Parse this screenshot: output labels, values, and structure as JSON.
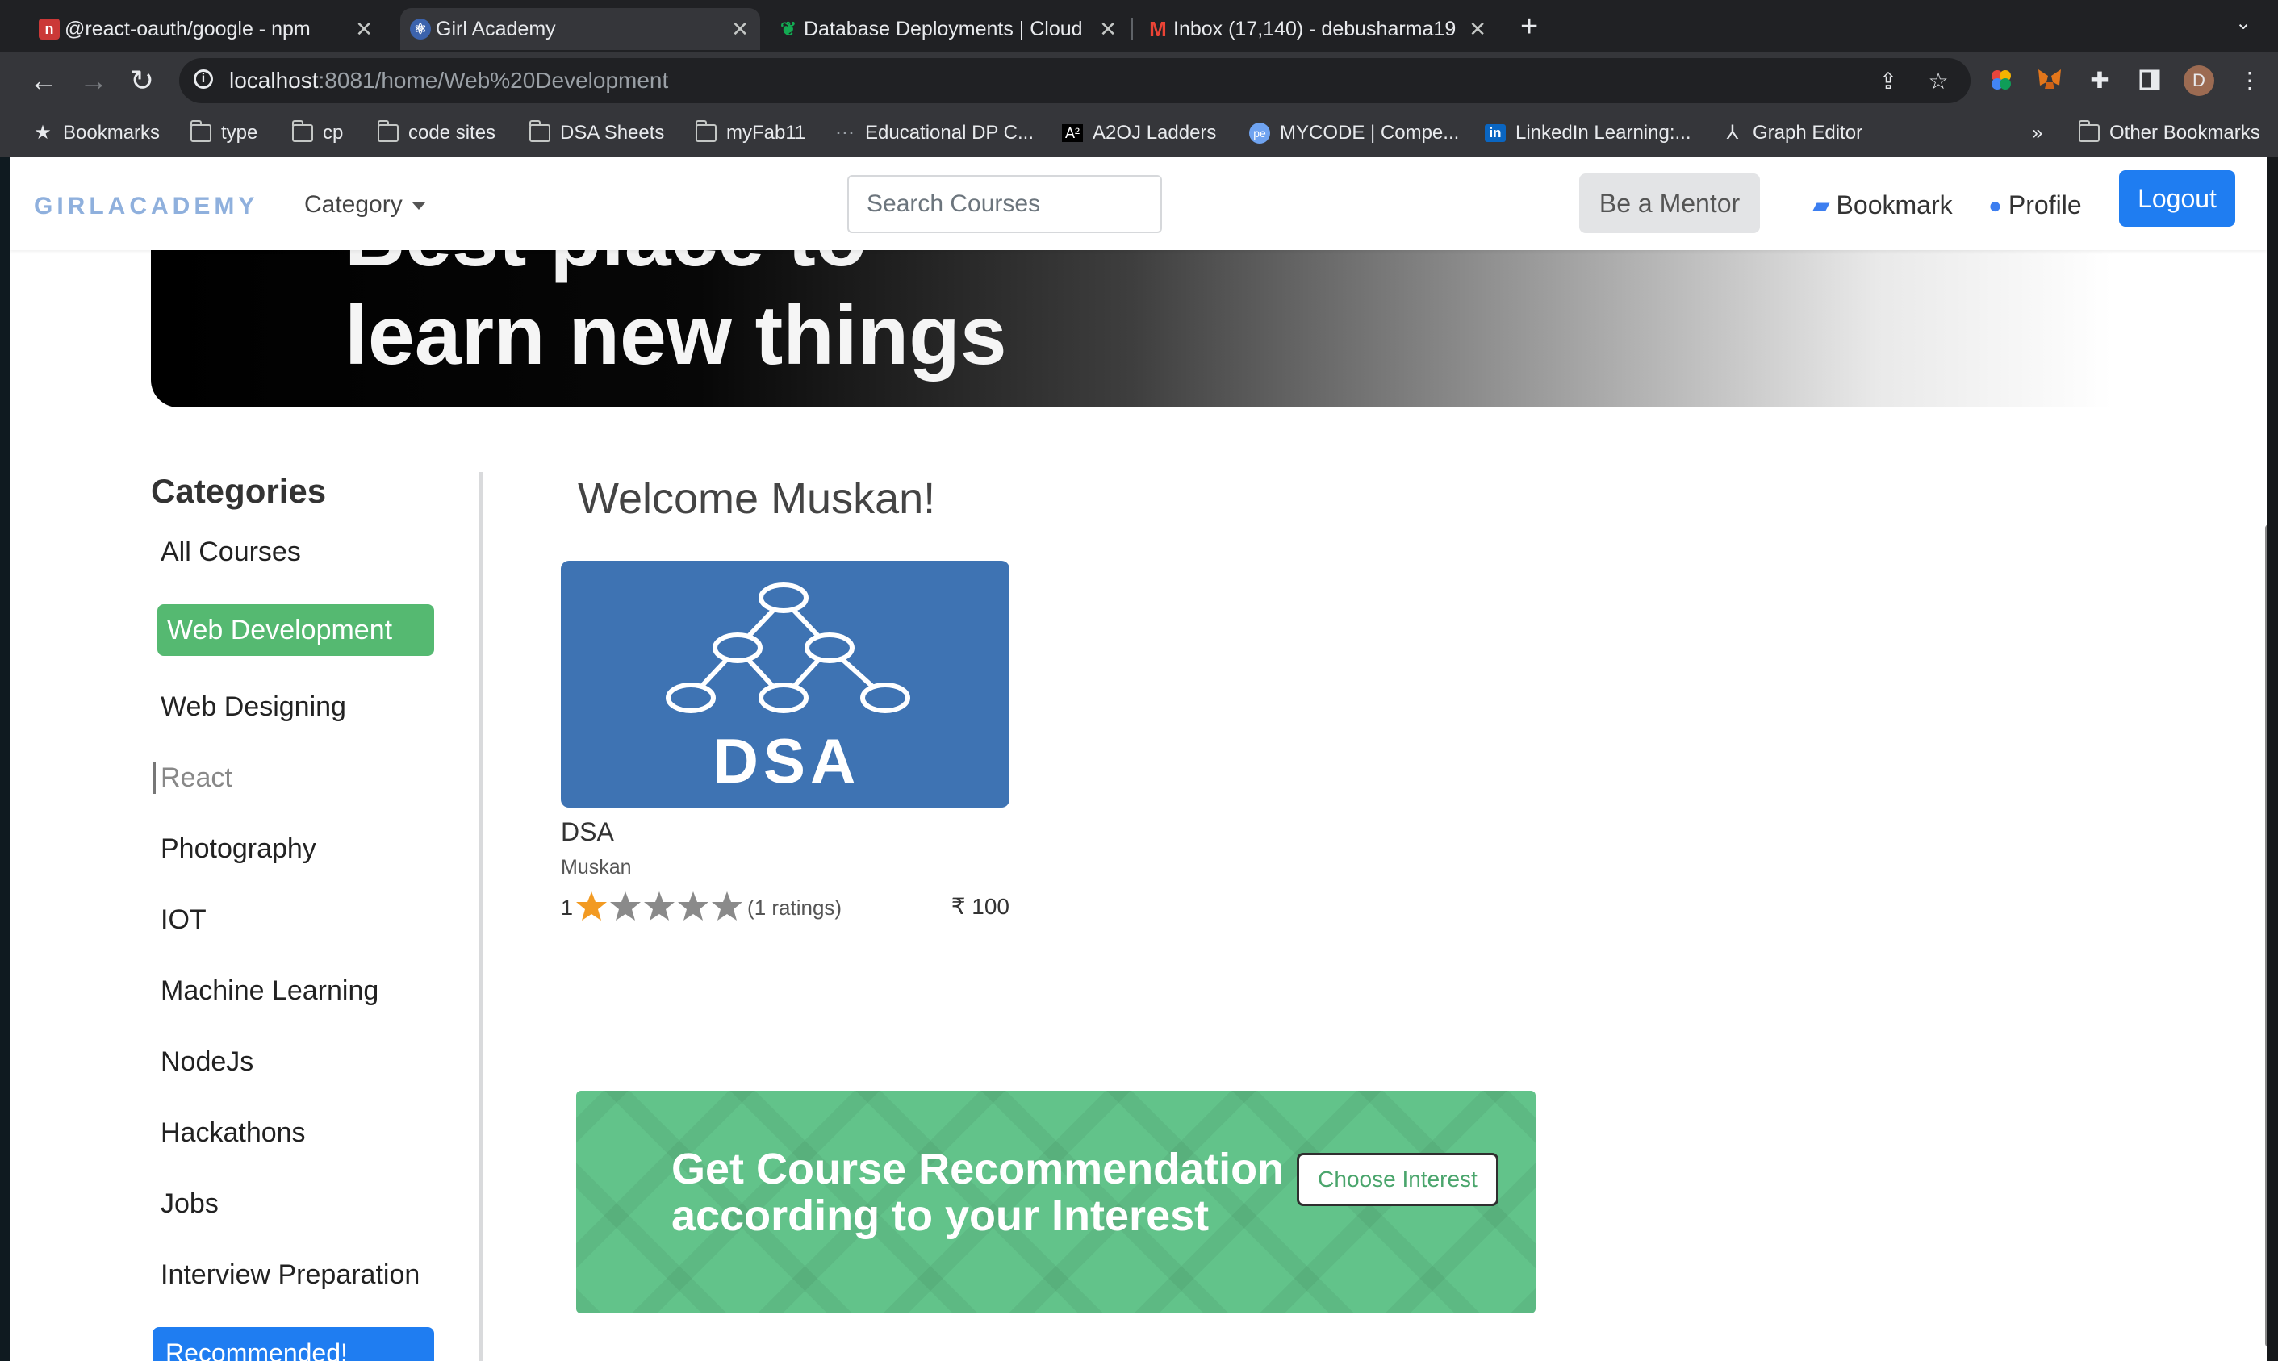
{
  "browser": {
    "tabs": [
      {
        "title": "@react-oauth/google - npm",
        "favicon": "npm-icon",
        "color": "#cb3837",
        "active": false
      },
      {
        "title": "Girl Academy",
        "favicon": "react-icon",
        "color": "#61dafb",
        "active": true
      },
      {
        "title": "Database Deployments | Cloud",
        "favicon": "mongodb-leaf-icon",
        "color": "#13aa52",
        "active": false
      },
      {
        "title": "Inbox (17,140) - debusharma19",
        "favicon": "gmail-icon",
        "color": "#ea4335",
        "active": false
      }
    ],
    "address": {
      "host": "localhost",
      "rest": ":8081/home/Web%20Development"
    },
    "profile_initial": "D",
    "bookmarks": [
      {
        "label": "Bookmarks",
        "icon": "star-icon"
      },
      {
        "label": "type",
        "icon": "folder-icon"
      },
      {
        "label": "cp",
        "icon": "folder-icon"
      },
      {
        "label": "code sites",
        "icon": "folder-icon"
      },
      {
        "label": "DSA Sheets",
        "icon": "folder-icon"
      },
      {
        "label": "myFab11",
        "icon": "folder-icon"
      },
      {
        "label": "Educational DP C...",
        "icon": "site-icon"
      },
      {
        "label": "A2OJ Ladders",
        "icon": "a2oj-icon"
      },
      {
        "label": "MYCODE | Compe...",
        "icon": "mycode-icon"
      },
      {
        "label": "LinkedIn Learning:...",
        "icon": "linkedin-icon"
      },
      {
        "label": "Graph Editor",
        "icon": "graph-icon"
      }
    ],
    "bookmarks_overflow": "»",
    "other_bookmarks": "Other Bookmarks"
  },
  "navbar": {
    "brand": "GIRLACADEMY",
    "category_label": "Category",
    "search_placeholder": "Search Courses",
    "mentor_label": "Be a Mentor",
    "bookmark_label": "Bookmark",
    "profile_label": "Profile",
    "logout_label": "Logout"
  },
  "hero": {
    "line1": "Best place to",
    "line2": "learn new things"
  },
  "sidebar": {
    "title": "Categories",
    "items": [
      {
        "label": "All Courses"
      },
      {
        "label": "Web Development"
      },
      {
        "label": "Web Designing"
      },
      {
        "label": "React"
      },
      {
        "label": "Photography"
      },
      {
        "label": "IOT"
      },
      {
        "label": "Machine Learning"
      },
      {
        "label": "NodeJs"
      },
      {
        "label": "Hackathons"
      },
      {
        "label": "Jobs"
      },
      {
        "label": "Interview Preparation"
      }
    ],
    "recommended_label": "Recommended!"
  },
  "main": {
    "welcome": "Welcome Muskan!",
    "course": {
      "thumb_text": "DSA",
      "name": "DSA",
      "author": "Muskan",
      "rating": "1",
      "rating_stars": 1,
      "rating_max": 5,
      "rating_count": "(1 ratings)",
      "price": "₹ 100"
    },
    "recommendation": {
      "line1": "Get Course Recommendation",
      "line2": "according to your Interest",
      "button": "Choose Interest"
    }
  },
  "colors": {
    "accent_blue": "#1f7df1",
    "active_green": "#55b971",
    "banner_green": "#62c38a",
    "star_filled": "#f29a22",
    "star_empty": "#8a8a8a"
  }
}
